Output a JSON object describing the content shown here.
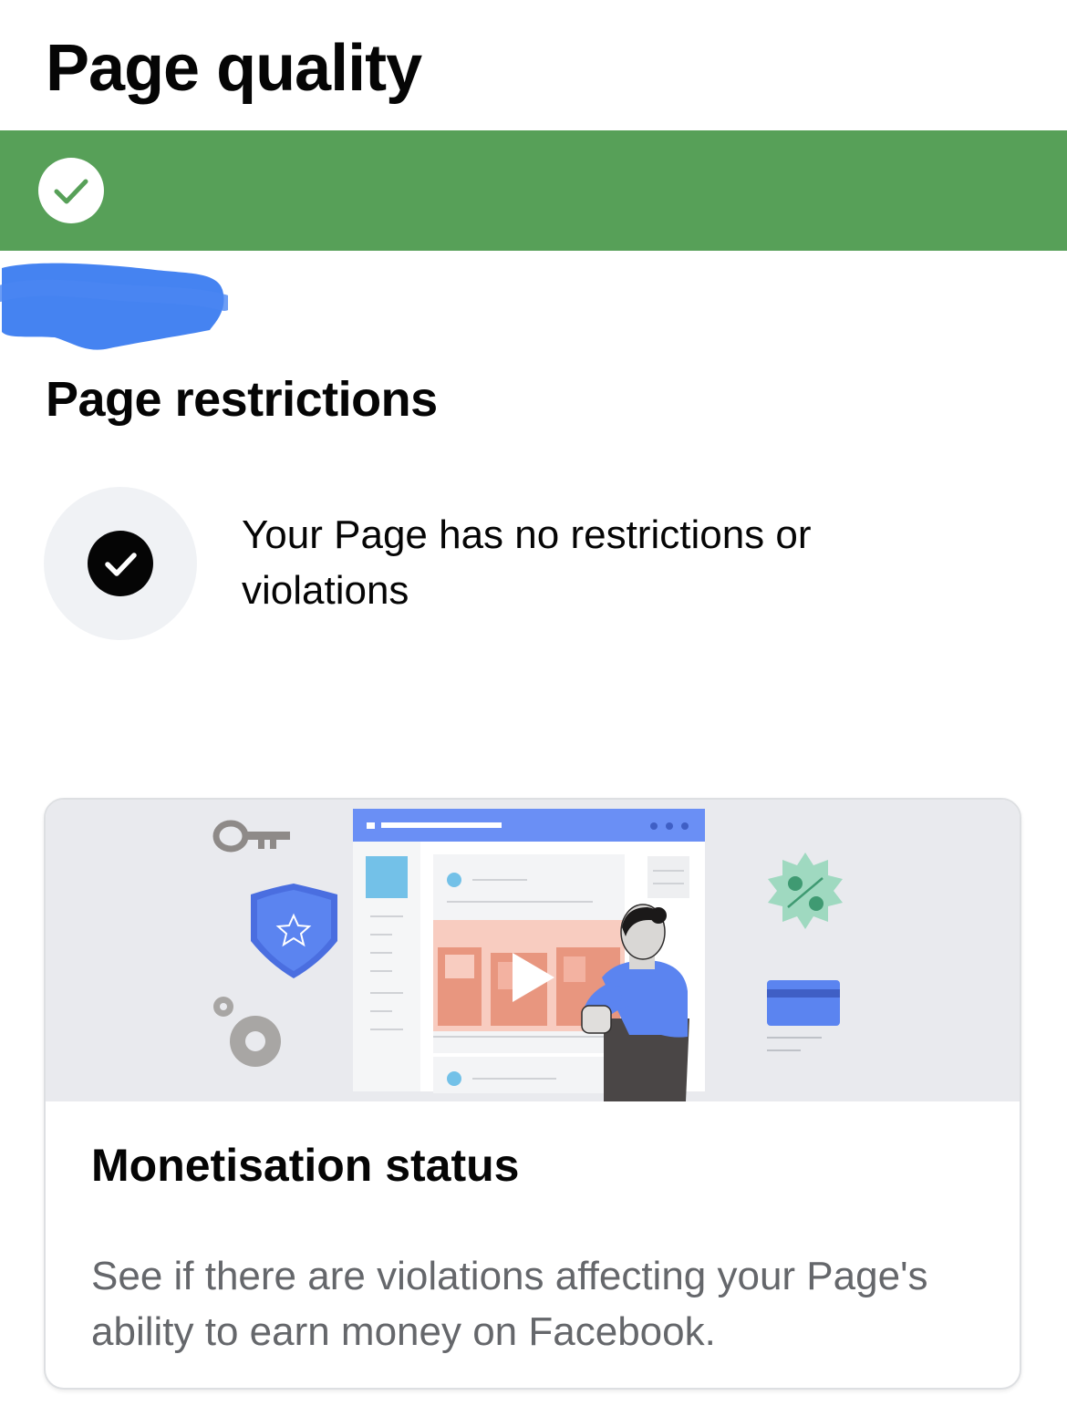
{
  "header": {
    "title": "Page quality"
  },
  "status_banner": {
    "color": "#57a058",
    "icon": "checkmark-icon"
  },
  "restrictions": {
    "title": "Page restrictions",
    "status_text": "Your Page has no restrictions or violations",
    "icon": "checkmark-icon"
  },
  "monetisation_card": {
    "title": "Monetisation status",
    "description": "See if there are violations affecting your Page's ability to earn money on Facebook.",
    "illustration_icons": [
      "key-icon",
      "shield-star-icon",
      "gear-icon",
      "video-play-icon",
      "discount-badge-icon",
      "credit-card-icon"
    ]
  }
}
